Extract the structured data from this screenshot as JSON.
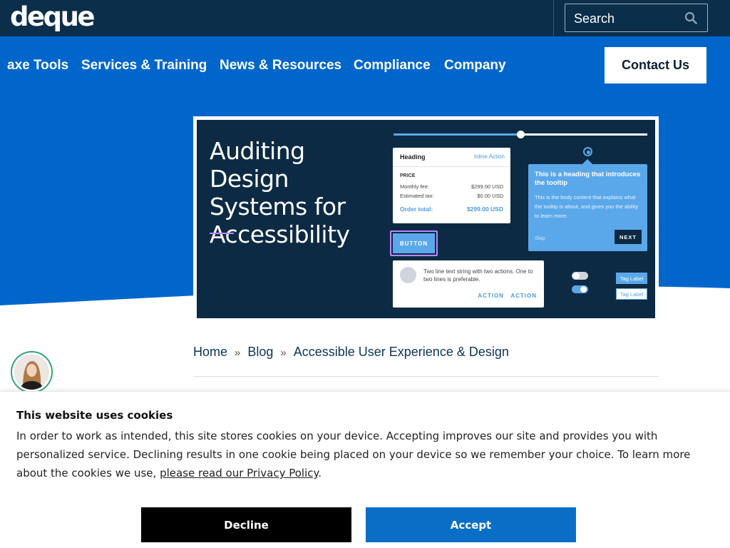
{
  "header": {
    "logo_text": "deque",
    "search_placeholder": "Search",
    "search_icon": "search-icon"
  },
  "nav": {
    "items": [
      "axe Tools",
      "Services & Training",
      "News & Resources",
      "Compliance",
      "Company"
    ],
    "contact_label": "Contact Us"
  },
  "hero": {
    "title": "Auditing Design Systems for Accessibility",
    "card1": {
      "heading": "Heading",
      "inline_action": "Inline Action",
      "price_label": "PRICE",
      "rows": [
        {
          "label": "Monthly fee:",
          "value": "$299.00 USD"
        },
        {
          "label": "Estimated tax:",
          "value": "$0.00 USD"
        }
      ],
      "total_label": "Order total:",
      "total_value": "$299.00 USD"
    },
    "button_label": "BUTTON",
    "card2": {
      "text": "Two line text string with two actions. One to two lines is preferable.",
      "actions": "ACTION   ACTION"
    },
    "tooltip": {
      "heading": "This is a heading that introduces the tooltip",
      "body": "This is the body content that explains what the tooltip is about, and gives you the ability to learn more.",
      "skip": "Skip",
      "next": "NEXT"
    },
    "tags": [
      "Tag Label",
      "Tag Label"
    ]
  },
  "breadcrumb": {
    "items": [
      "Home",
      "Blog",
      "Accessible User Experience & Design"
    ],
    "separator": "»"
  },
  "cookie": {
    "title": "This website uses cookies",
    "body": "In order to work as intended, this site stores cookies on your device. Accepting improves our site and provides you with personalized service. Declining results in one cookie being placed on your device so we remember your choice. To learn more about the cookies we use, ",
    "link_text": "please read our Privacy Policy",
    "body_end": ".",
    "decline_label": "Decline",
    "accept_label": "Accept"
  },
  "colors": {
    "brand_dark": "#0b2e4a",
    "brand_blue": "#0066cc",
    "accent_purple": "#b889ff",
    "ui_light_blue": "#5aa8ea",
    "decline_bg": "#000000",
    "accept_bg": "#0a6ec6"
  }
}
